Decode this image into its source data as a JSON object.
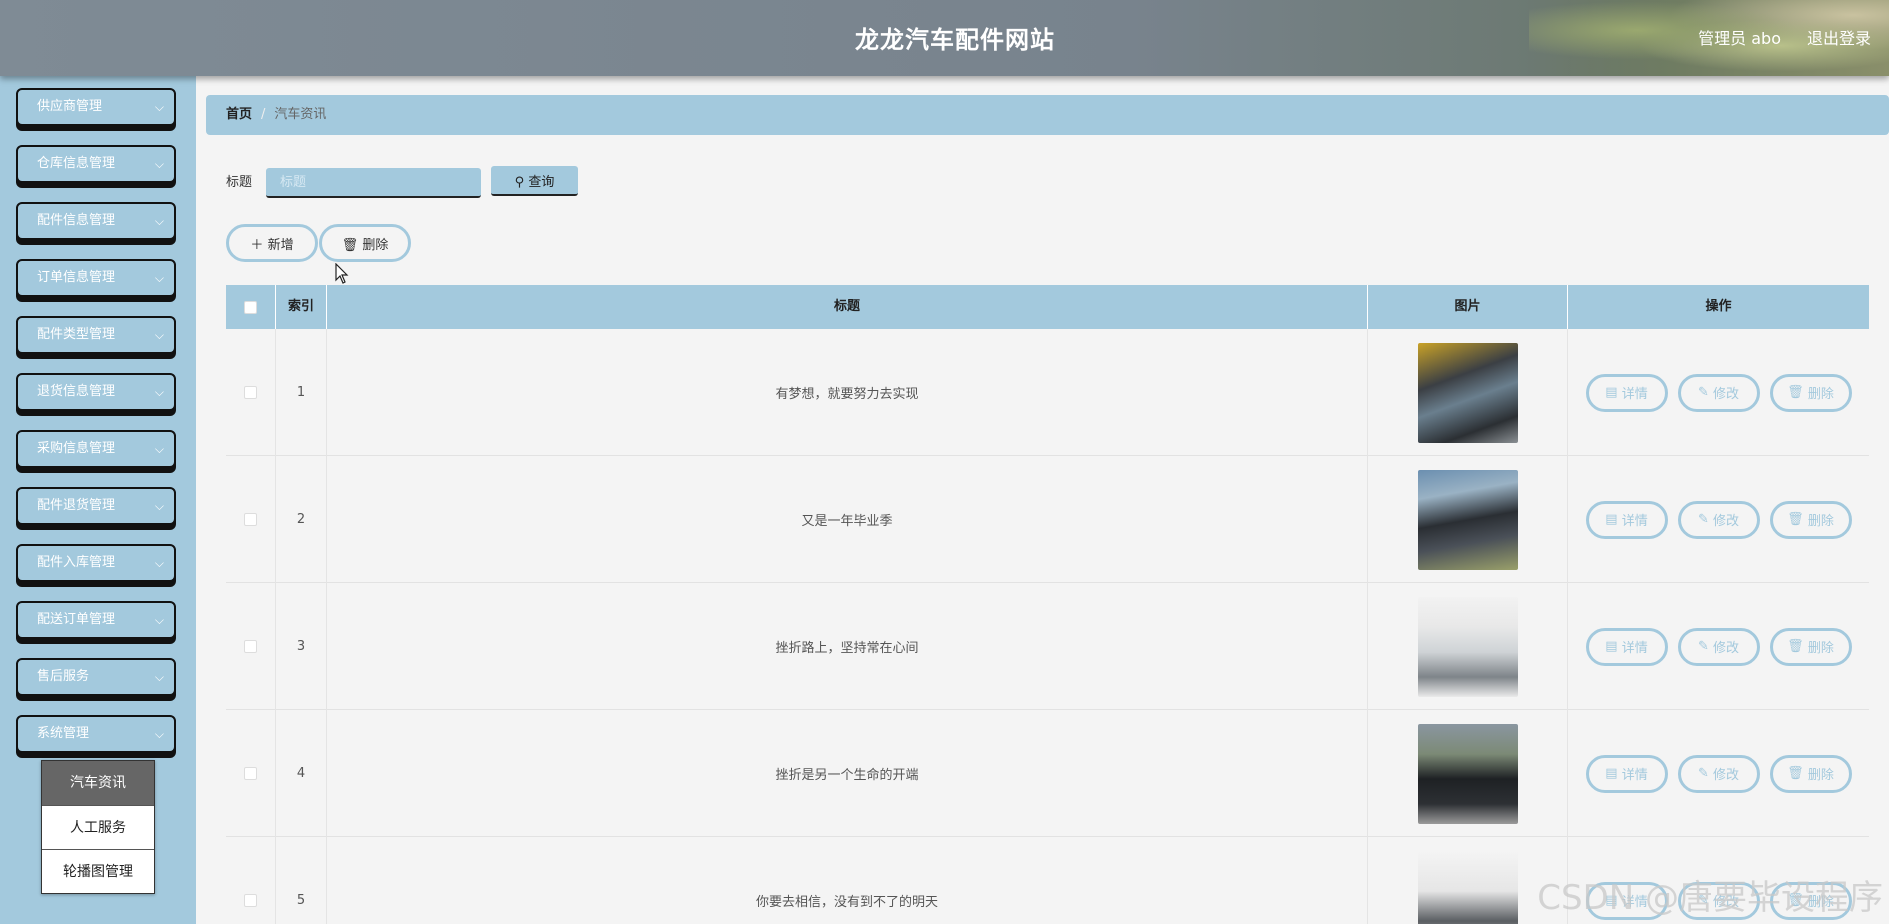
{
  "header": {
    "title": "龙龙汽车配件网站",
    "user": "管理员 abo",
    "logout": "退出登录"
  },
  "sidebar": {
    "items": [
      {
        "label": "供应商管理"
      },
      {
        "label": "仓库信息管理"
      },
      {
        "label": "配件信息管理"
      },
      {
        "label": "订单信息管理"
      },
      {
        "label": "配件类型管理"
      },
      {
        "label": "退货信息管理"
      },
      {
        "label": "采购信息管理"
      },
      {
        "label": "配件退货管理"
      },
      {
        "label": "配件入库管理"
      },
      {
        "label": "配送订单管理"
      },
      {
        "label": "售后服务"
      },
      {
        "label": "系统管理"
      }
    ],
    "submenu": [
      {
        "label": "汽车资讯",
        "active": true
      },
      {
        "label": "人工服务",
        "active": false
      },
      {
        "label": "轮播图管理",
        "active": false
      }
    ]
  },
  "breadcrumb": {
    "home": "首页",
    "separator": "/",
    "current": "汽车资讯"
  },
  "search": {
    "label": "标题",
    "placeholder": "标题",
    "button": "查询"
  },
  "toolbar": {
    "add": "新增",
    "delete": "删除"
  },
  "table": {
    "headers": {
      "index": "索引",
      "title": "标题",
      "image": "图片",
      "actions": "操作"
    },
    "actions": {
      "detail": "详情",
      "edit": "修改",
      "delete": "删除"
    },
    "rows": [
      {
        "index": "1",
        "title": "有梦想，就要努力去实现"
      },
      {
        "index": "2",
        "title": "又是一年毕业季"
      },
      {
        "index": "3",
        "title": "挫折路上，坚持常在心间"
      },
      {
        "index": "4",
        "title": "挫折是另一个生命的开端"
      },
      {
        "index": "5",
        "title": "你要去相信，没有到不了的明天"
      }
    ]
  },
  "watermark": "CSDN @唐要毕设程序",
  "colors": {
    "accent": "#a3c9dd",
    "header": "#7f8b95",
    "background": "#f4f4f4"
  }
}
